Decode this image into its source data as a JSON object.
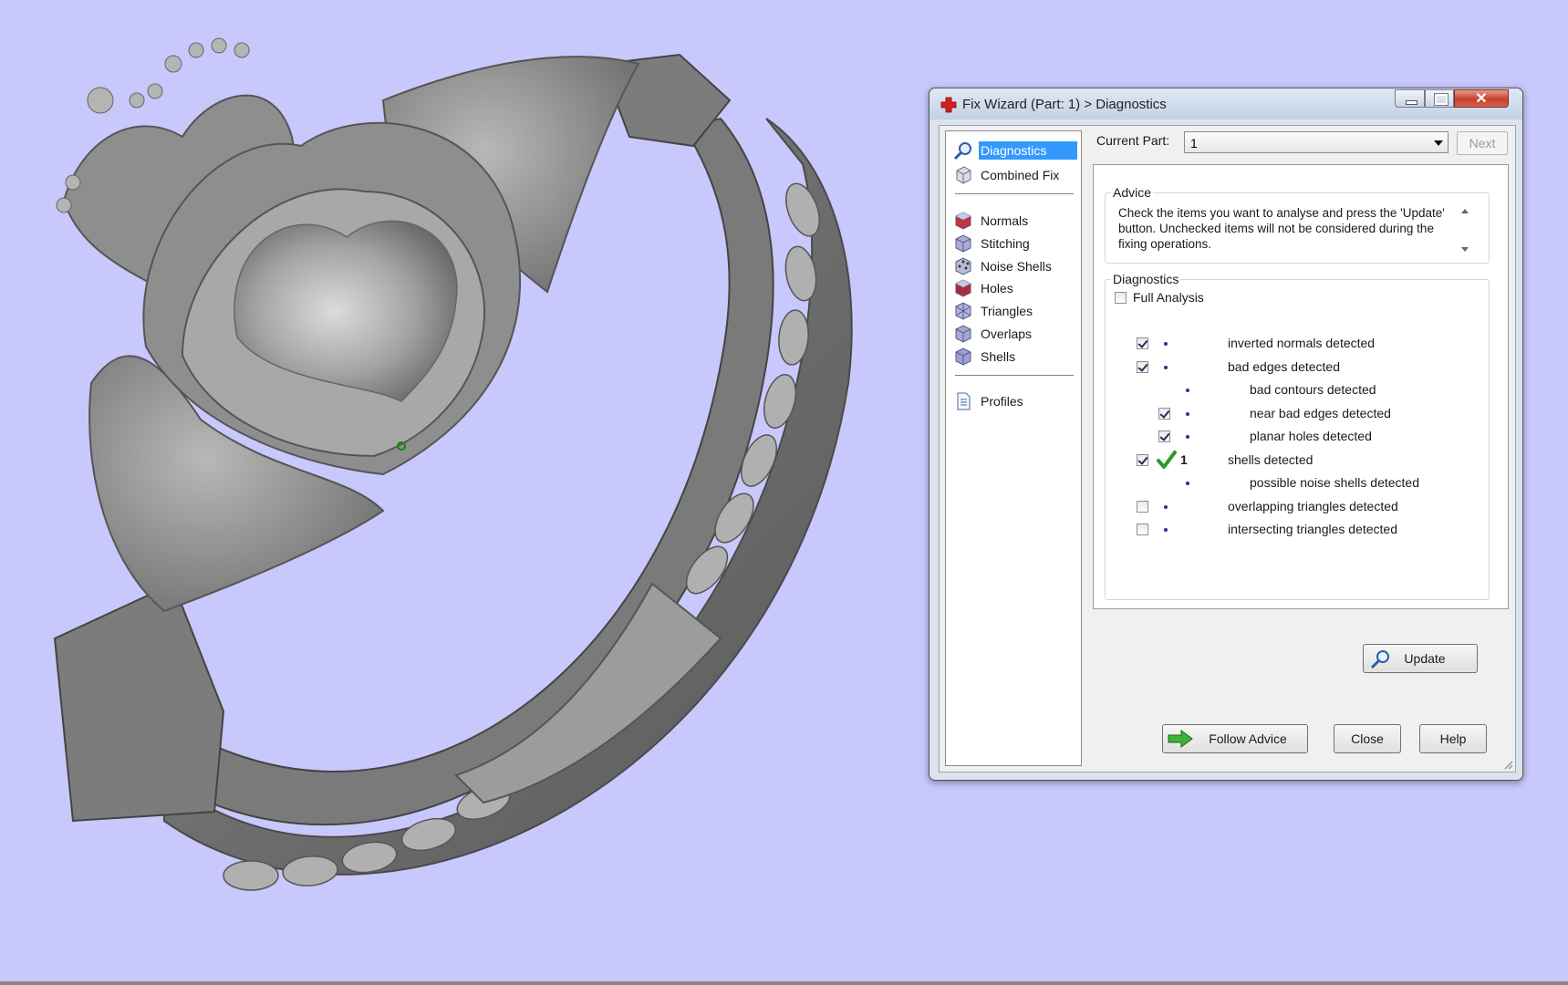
{
  "window": {
    "title": "Fix Wizard (Part: 1) > Diagnostics",
    "close_symbol": "✕"
  },
  "nav": {
    "items": [
      {
        "label": "Diagnostics",
        "icon": "magnifier-icon",
        "selected": true
      },
      {
        "label": "Combined Fix",
        "icon": "combined-fix-icon"
      },
      {
        "label": "Normals",
        "icon": "normals-cube-icon"
      },
      {
        "label": "Stitching",
        "icon": "stitching-cube-icon"
      },
      {
        "label": "Noise Shells",
        "icon": "noise-shells-cube-icon"
      },
      {
        "label": "Holes",
        "icon": "holes-cube-icon"
      },
      {
        "label": "Triangles",
        "icon": "triangles-cube-icon"
      },
      {
        "label": "Overlaps",
        "icon": "overlaps-cube-icon"
      },
      {
        "label": "Shells",
        "icon": "shells-cube-icon"
      },
      {
        "label": "Profiles",
        "icon": "profiles-document-icon"
      }
    ]
  },
  "current_part": {
    "label": "Current Part:",
    "value": "1",
    "next_label": "Next"
  },
  "advice": {
    "legend": "Advice",
    "text": "Check the items you want to analyse and press the 'Update' button. Unchecked items will not be considered during the fixing operations."
  },
  "diagnostics": {
    "legend": "Diagnostics",
    "full_analysis": {
      "label": "Full Analysis",
      "checked": false
    },
    "rows": [
      {
        "label": "inverted normals detected",
        "checked": true,
        "has_checkbox": true,
        "indent": 0,
        "count": ""
      },
      {
        "label": "bad edges detected",
        "checked": true,
        "has_checkbox": true,
        "indent": 0,
        "count": ""
      },
      {
        "label": "bad contours detected",
        "checked": false,
        "has_checkbox": false,
        "indent": 1,
        "count": ""
      },
      {
        "label": "near bad edges detected",
        "checked": true,
        "has_checkbox": true,
        "indent": 1,
        "count": ""
      },
      {
        "label": "planar holes detected",
        "checked": true,
        "has_checkbox": true,
        "indent": 1,
        "count": ""
      },
      {
        "label": "shells detected",
        "checked": true,
        "has_checkbox": true,
        "indent": 0,
        "count": "1",
        "status": "ok"
      },
      {
        "label": "possible noise shells detected",
        "checked": false,
        "has_checkbox": false,
        "indent": 1,
        "count": ""
      },
      {
        "label": "overlapping triangles detected",
        "checked": false,
        "has_checkbox": true,
        "indent": 0,
        "count": ""
      },
      {
        "label": "intersecting triangles detected",
        "checked": false,
        "has_checkbox": true,
        "indent": 0,
        "count": ""
      }
    ],
    "update_label": "Update"
  },
  "footer": {
    "follow_advice_label": "Follow Advice",
    "close_label": "Close",
    "help_label": "Help"
  },
  "colors": {
    "viewport_background": "#c8c8fc",
    "selection": "#3399ff",
    "ok_check": "#2a9a2a",
    "model_gray": "#8a8a8a"
  }
}
